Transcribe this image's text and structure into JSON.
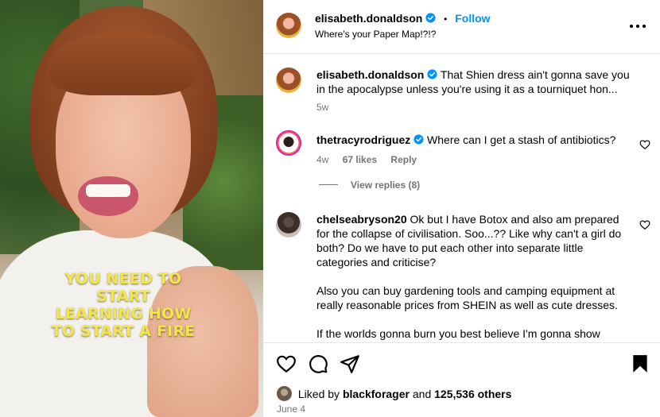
{
  "media": {
    "caption_lines": [
      "YOU NEED TO START",
      "LEARNING HOW",
      "TO START A FIRE"
    ]
  },
  "post": {
    "author": "elisabeth.donaldson",
    "follow_label": "Follow",
    "separator": "•",
    "subtitle": "Where's your Paper Map!?!?"
  },
  "comments": [
    {
      "username": "elisabeth.donaldson",
      "verified": true,
      "text": "That Shien dress ain't gonna save you in the apocalypse unless you're using it as a tourniquet hon...",
      "time": "5w"
    },
    {
      "username": "thetracyrodriguez",
      "verified": true,
      "text": "Where can I get a stash of antibiotics?",
      "time": "4w",
      "likes": "67 likes",
      "reply_label": "Reply",
      "view_replies": "View replies (8)"
    },
    {
      "username": "chelseabryson20",
      "verified": false,
      "paragraphs": [
        "Ok but I have Botox and also am prepared for the collapse of civilisation. Soo...?? Like why can't a girl do both? Do we have to put each other into separate little categories and criticise?",
        "Also you can buy gardening tools and camping equipment at really reasonable prices from SHEIN as well as cute dresses.",
        "If the worlds gonna burn you best believe I'm gonna show"
      ]
    }
  ],
  "footer": {
    "liked_prefix": "Liked by",
    "liked_user": "blackforager",
    "liked_and": "and",
    "liked_count": "125,536 others",
    "date": "June 4"
  },
  "colors": {
    "accent": "#0095f6",
    "caption": "#f4e64a",
    "muted": "#737373"
  }
}
